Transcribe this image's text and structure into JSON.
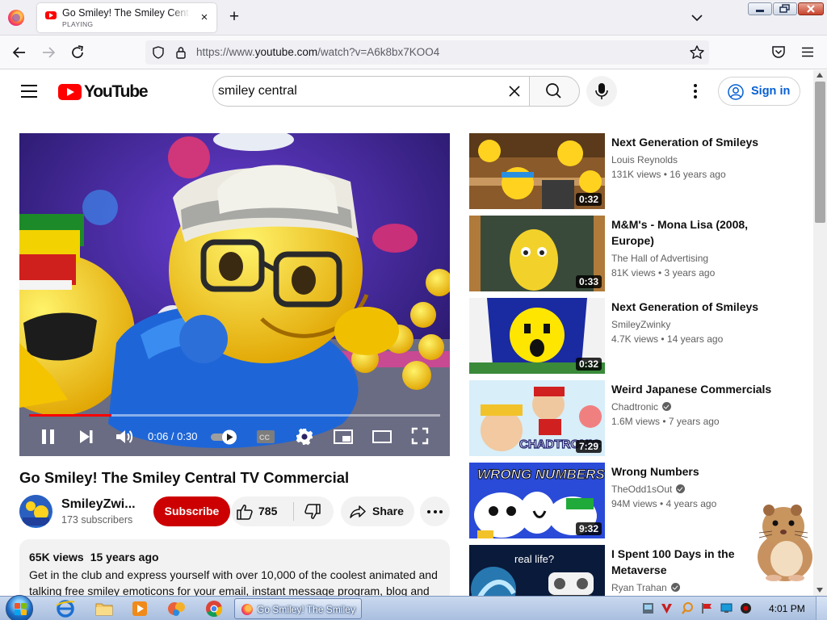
{
  "browser": {
    "tab": {
      "title": "Go Smiley! The Smiley Central TV Commercial - YouTube",
      "status": "PLAYING",
      "close_label": "×"
    },
    "new_tab_label": "+",
    "url": {
      "prefix": "https://www.",
      "domain": "youtube.com",
      "path": "/watch?v=A6k8bx7KOO4"
    }
  },
  "youtube": {
    "logo_text": "YouTube",
    "search": {
      "value": "smiley central",
      "clear_label": "✕"
    },
    "sign_in_label": "Sign in",
    "colors": {
      "brand_red": "#ff0000",
      "link_blue": "#065fd4",
      "subscribe_red": "#cc0000"
    }
  },
  "player": {
    "time": "0:06 / 0:30",
    "progress_fraction": 0.2
  },
  "video": {
    "title": "Go Smiley! The Smiley Central TV Commercial",
    "channel": {
      "name": "SmileyZwi...",
      "subscribers": "173 subscribers"
    },
    "subscribe_label": "Subscribe",
    "likes": "785",
    "share_label": "Share",
    "description": {
      "views": "65K views",
      "age": "15 years ago",
      "text": "Get in the club and express yourself with over 10,000 of the coolest animated and talking free smiley emoticons for your email, instant message program, blog and"
    }
  },
  "related": [
    {
      "title": "Next Generation of Smileys",
      "channel": "Louis Reynolds",
      "verified": false,
      "meta": "131K views • 16 years ago",
      "duration": "0:32"
    },
    {
      "title": "M&M's - Mona Lisa (2008, Europe)",
      "channel": "The Hall of Advertising",
      "verified": false,
      "meta": "81K views • 3 years ago",
      "duration": "0:33"
    },
    {
      "title": "Next Generation of Smileys",
      "channel": "SmileyZwinky",
      "verified": false,
      "meta": "4.7K views • 14 years ago",
      "duration": "0:32"
    },
    {
      "title": "Weird Japanese Commercials",
      "channel": "Chadtronic",
      "verified": true,
      "meta": "1.6M views • 7 years ago",
      "duration": "7:29"
    },
    {
      "title": "Wrong Numbers",
      "channel": "TheOdd1sOut",
      "verified": true,
      "meta": "94M views • 4 years ago",
      "duration": "9:32"
    },
    {
      "title": "I Spent 100 Days in the Metaverse",
      "channel": "Ryan Trahan",
      "verified": true,
      "meta": "",
      "duration": ""
    }
  ],
  "thumb_text": {
    "chadtronic": "CHADTRONIC",
    "wrong_numbers": "WRONG NUMBERS",
    "metaverse": "real life?"
  },
  "taskbar": {
    "active_task": "Go Smiley! The Smiley Central TV Commercial - YouTube - Mozilla Firefox",
    "clock": "4:01 PM"
  }
}
